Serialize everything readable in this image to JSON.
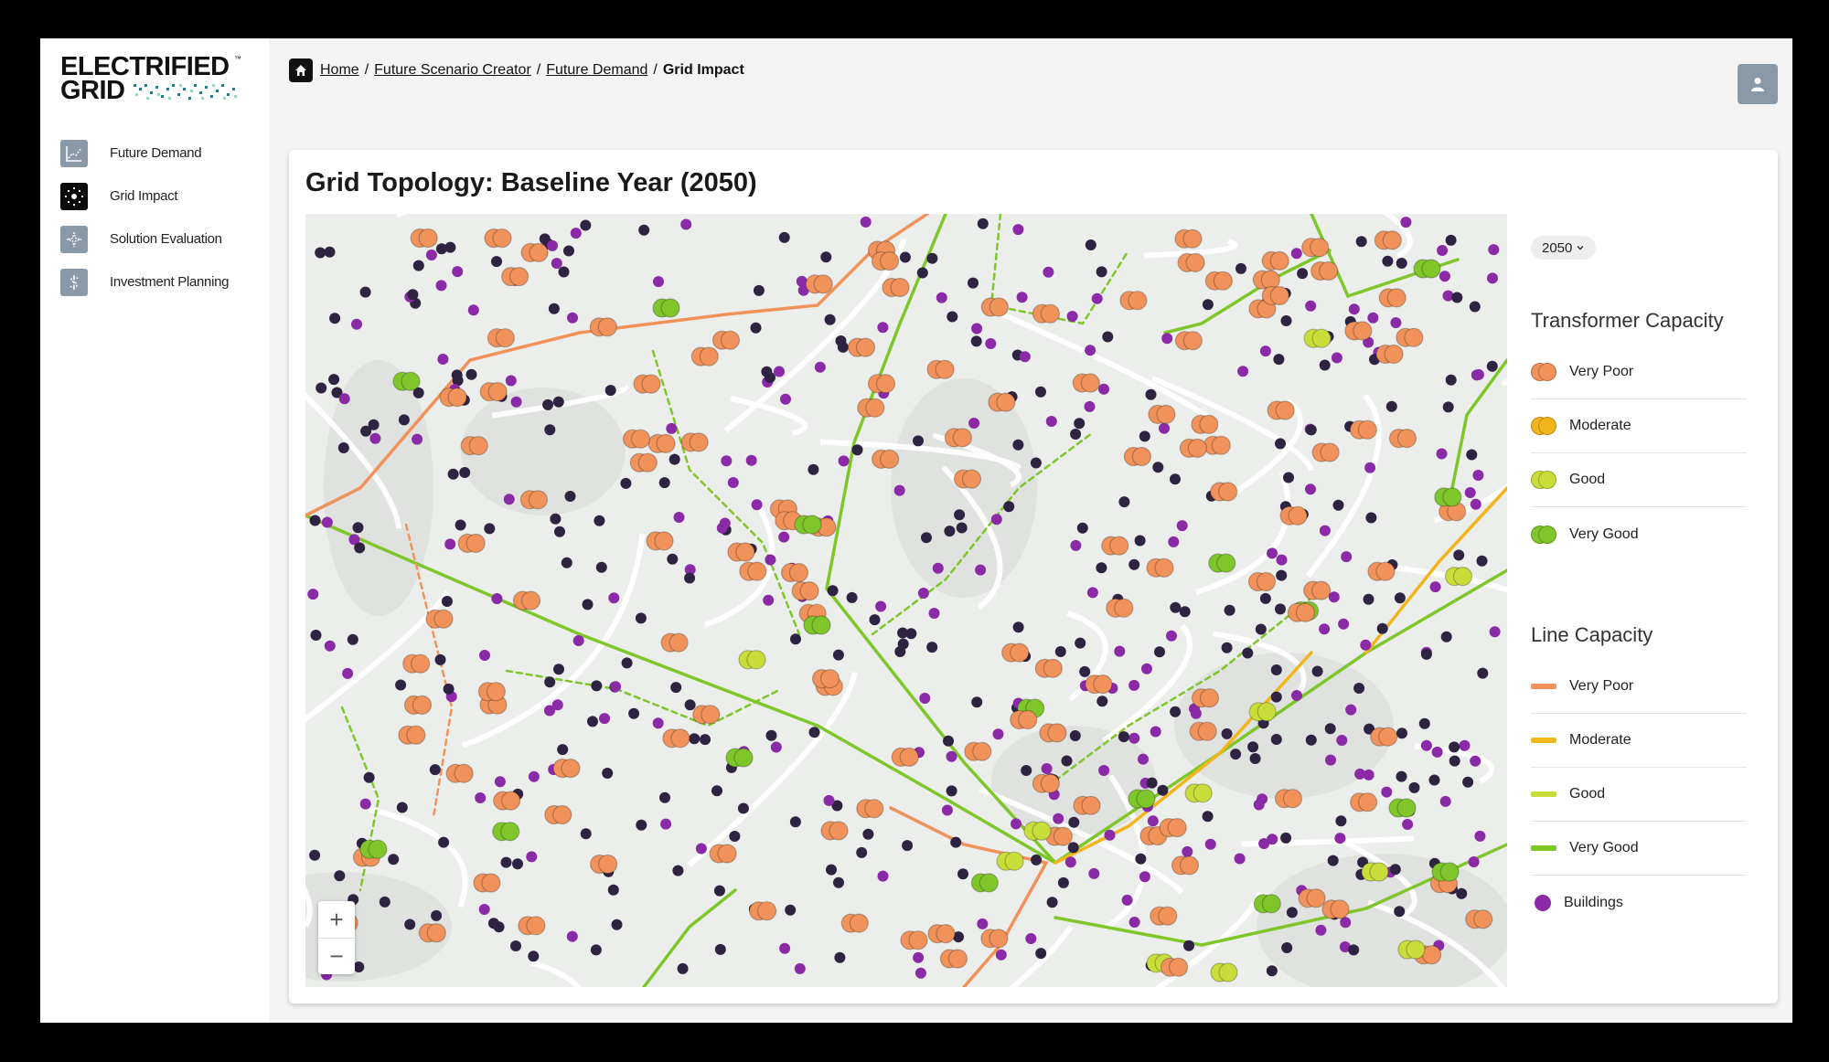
{
  "brand": {
    "line1": "ELECTRIFIED",
    "line2": "GRID",
    "tm": "™"
  },
  "nav": {
    "items": [
      {
        "label": "Future Demand",
        "icon": "chart-line-icon",
        "active": false
      },
      {
        "label": "Grid Impact",
        "icon": "grid-node-icon",
        "active": true
      },
      {
        "label": "Solution Evaluation",
        "icon": "sparkle-icon",
        "active": false
      },
      {
        "label": "Investment Planning",
        "icon": "dollar-icon",
        "active": false
      }
    ]
  },
  "breadcrumb": {
    "home": "Home",
    "sep": "/",
    "scenario": "Future Scenario Creator",
    "demand": "Future Demand",
    "current": "Grid Impact"
  },
  "card": {
    "title": "Grid Topology: Baseline Year (2050)"
  },
  "map": {
    "zoom_in": "+",
    "zoom_out": "−"
  },
  "year_select": {
    "value": "2050"
  },
  "colors": {
    "very_poor": "#f0925a",
    "moderate": "#f2b51c",
    "good": "#c9dd3a",
    "very_good": "#7fc62b",
    "building_dark": "#2e2340",
    "building": "#8a2aa6"
  },
  "legend_transformer": {
    "title": "Transformer Capacity",
    "items": [
      "Very Poor",
      "Moderate",
      "Good",
      "Very Good"
    ]
  },
  "legend_line": {
    "title": "Line Capacity",
    "items": [
      "Very Poor",
      "Moderate",
      "Good",
      "Very Good"
    ],
    "buildings": "Buildings"
  }
}
